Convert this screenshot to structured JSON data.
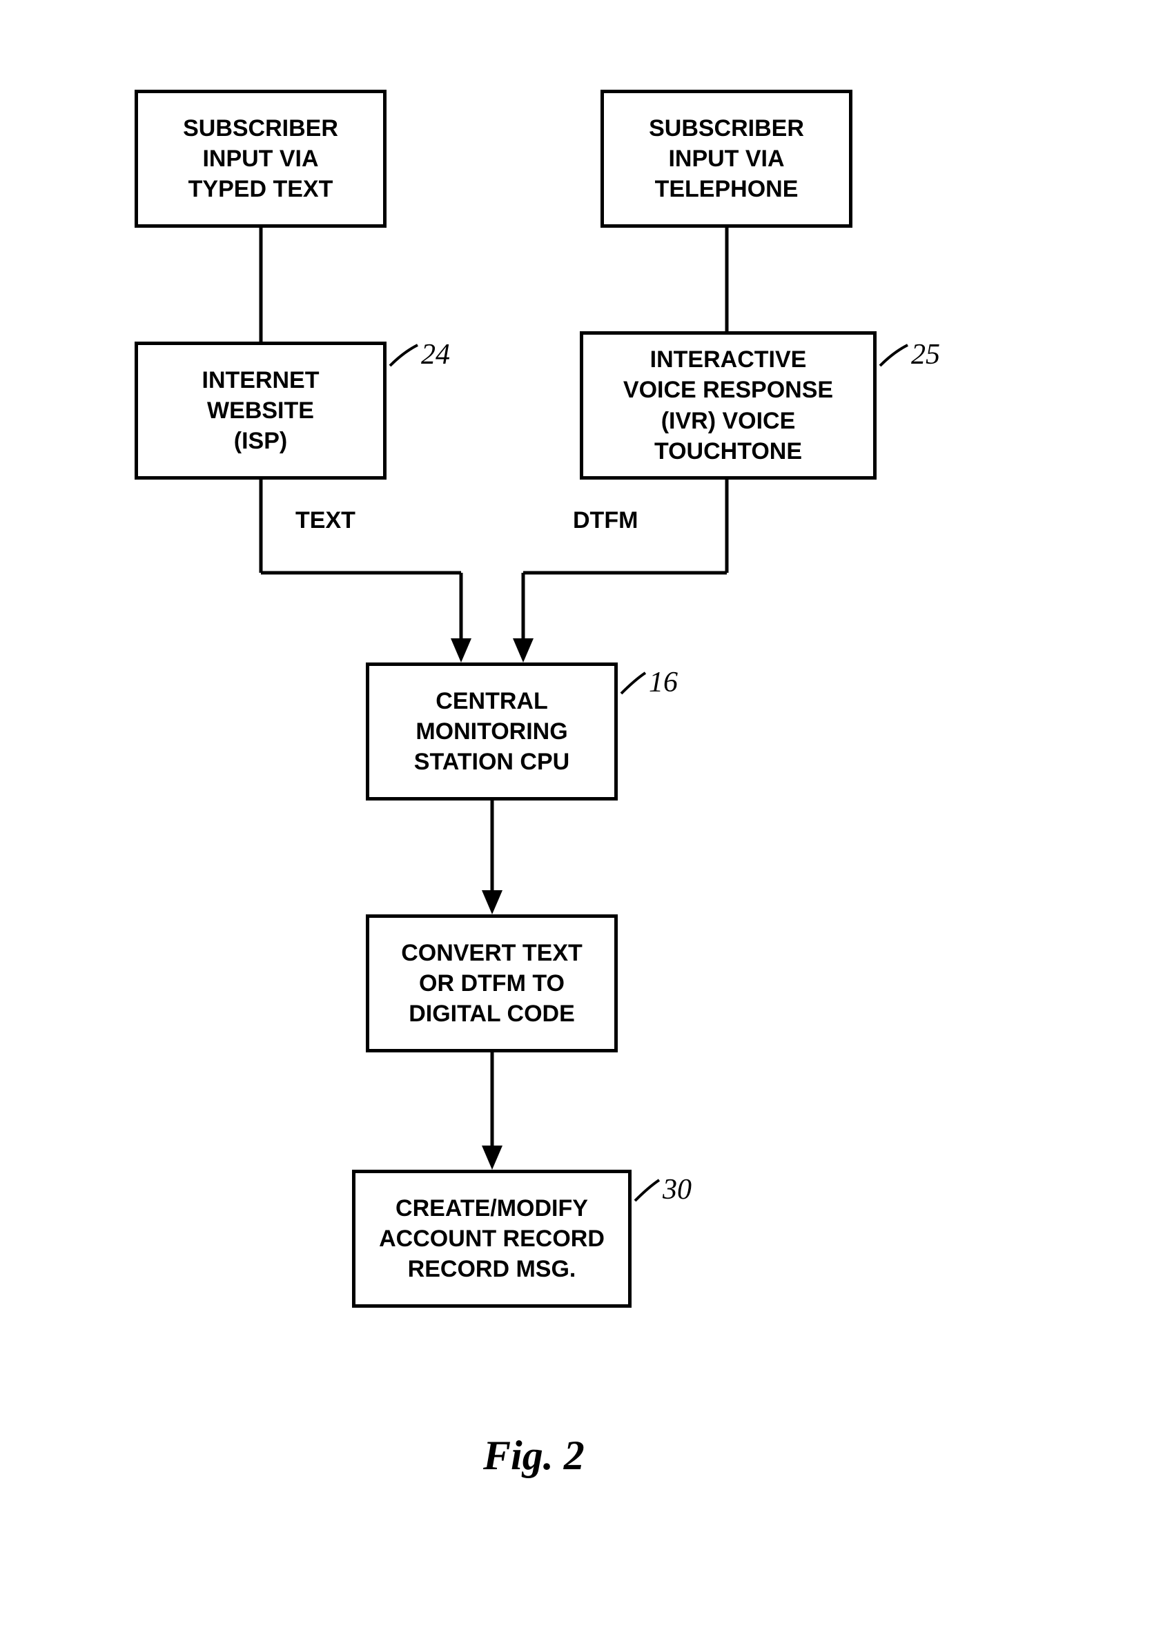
{
  "boxes": {
    "sub_text": "SUBSCRIBER\nINPUT VIA\nTYPED TEXT",
    "sub_phone": "SUBSCRIBER\nINPUT VIA\nTELEPHONE",
    "isp": "INTERNET\nWEBSITE\n(ISP)",
    "ivr": "INTERACTIVE\nVOICE RESPONSE\n(IVR) VOICE\nTOUCHTONE",
    "cpu": "CENTRAL\nMONITORING\nSTATION CPU",
    "convert": "CONVERT TEXT\nOR DTFM TO\nDIGITAL CODE",
    "create": "CREATE/MODIFY\nACCOUNT RECORD\nRECORD MSG."
  },
  "labels": {
    "isp_num": "24",
    "ivr_num": "25",
    "cpu_num": "16",
    "create_num": "30",
    "text_label": "TEXT",
    "dtfm_label": "DTFM"
  },
  "caption": "Fig. 2"
}
